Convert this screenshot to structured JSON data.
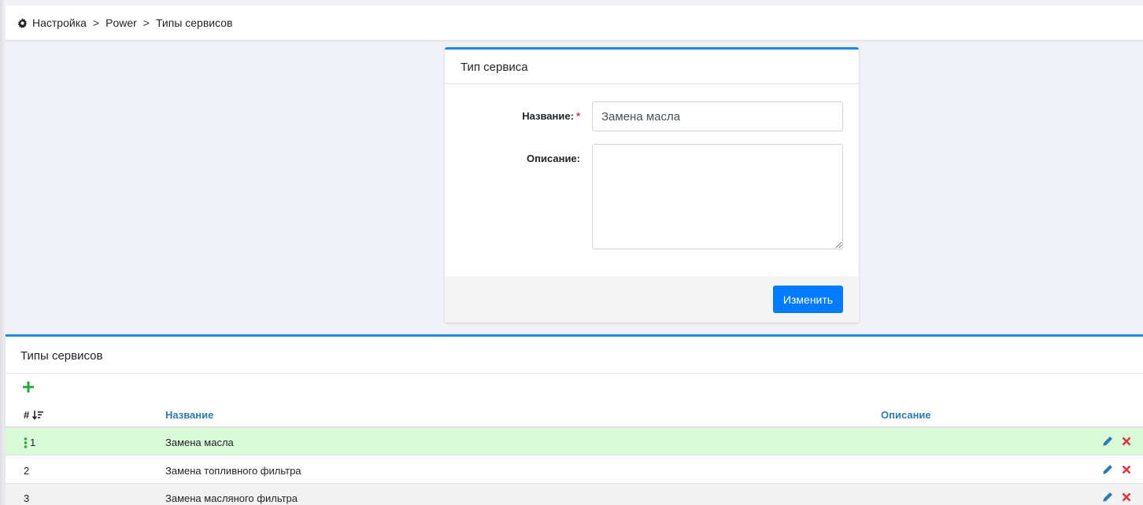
{
  "breadcrumb": {
    "items": [
      "Настройка",
      "Power",
      "Типы сервисов"
    ],
    "separator": ">"
  },
  "form": {
    "title": "Тип сервиса",
    "name_label": "Название:",
    "required_mark": "*",
    "name_value": "Замена масла",
    "description_label": "Описание:",
    "description_value": "",
    "submit_label": "Изменить"
  },
  "list": {
    "title": "Типы сервисов",
    "columns": {
      "num": "#",
      "name": "Название",
      "description": "Описание"
    },
    "rows": [
      {
        "num": "1",
        "name": "Замена масла",
        "description": ""
      },
      {
        "num": "2",
        "name": "Замена топливного фильтра",
        "description": ""
      },
      {
        "num": "3",
        "name": "Замена масляного фильтра",
        "description": ""
      }
    ]
  },
  "colors": {
    "accent": "#1e88e5",
    "primary_button": "#007bff",
    "selected_row": "#dafbd8",
    "add_icon": "#28a745",
    "edit_icon": "#2e7bae",
    "delete_icon": "#dc3545"
  },
  "icons": [
    "gear-icon",
    "plus-icon",
    "sort-desc-icon",
    "drag-handle-icon",
    "pencil-icon",
    "close-icon"
  ]
}
